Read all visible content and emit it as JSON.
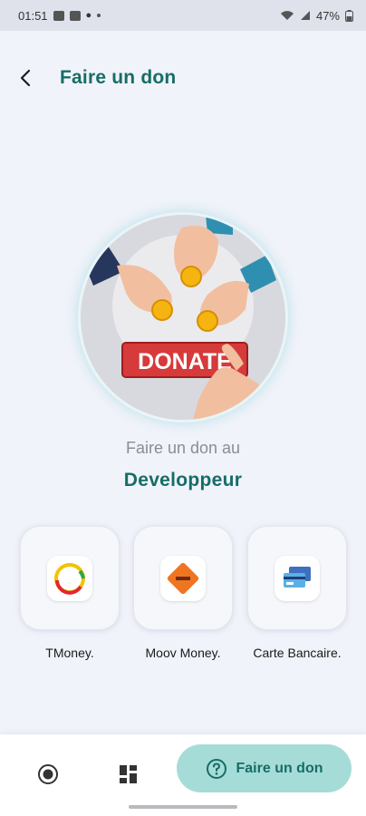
{
  "status_bar": {
    "time": "01:51",
    "battery": "47%",
    "icons": [
      "image-icon",
      "media-icon",
      "bulb-icon",
      "dot-icon",
      "wifi-icon",
      "signal-icon",
      "battery-icon"
    ]
  },
  "header": {
    "back_icon": "chevron-left-icon",
    "title": "Faire un don"
  },
  "hero": {
    "image": "donate-illustration",
    "button_text": "DONATE"
  },
  "intro": {
    "line1": "Faire un don au",
    "line2": "Developpeur"
  },
  "methods": [
    {
      "label": "TMoney.",
      "icon": "tmoney-logo"
    },
    {
      "label": "Moov Money.",
      "icon": "moov-money-logo"
    },
    {
      "label": "Carte Bancaire.",
      "icon": "bank-card-icon"
    }
  ],
  "bottom_nav": {
    "items": [
      {
        "icon": "record-icon"
      },
      {
        "icon": "grid-icon"
      }
    ],
    "active": {
      "icon": "help-circle-icon",
      "label": "Faire un don"
    }
  },
  "colors": {
    "accent": "#166d67",
    "pill": "#a6dcd8",
    "background": "#f1f3fa",
    "donate_red": "#d63a3a"
  }
}
